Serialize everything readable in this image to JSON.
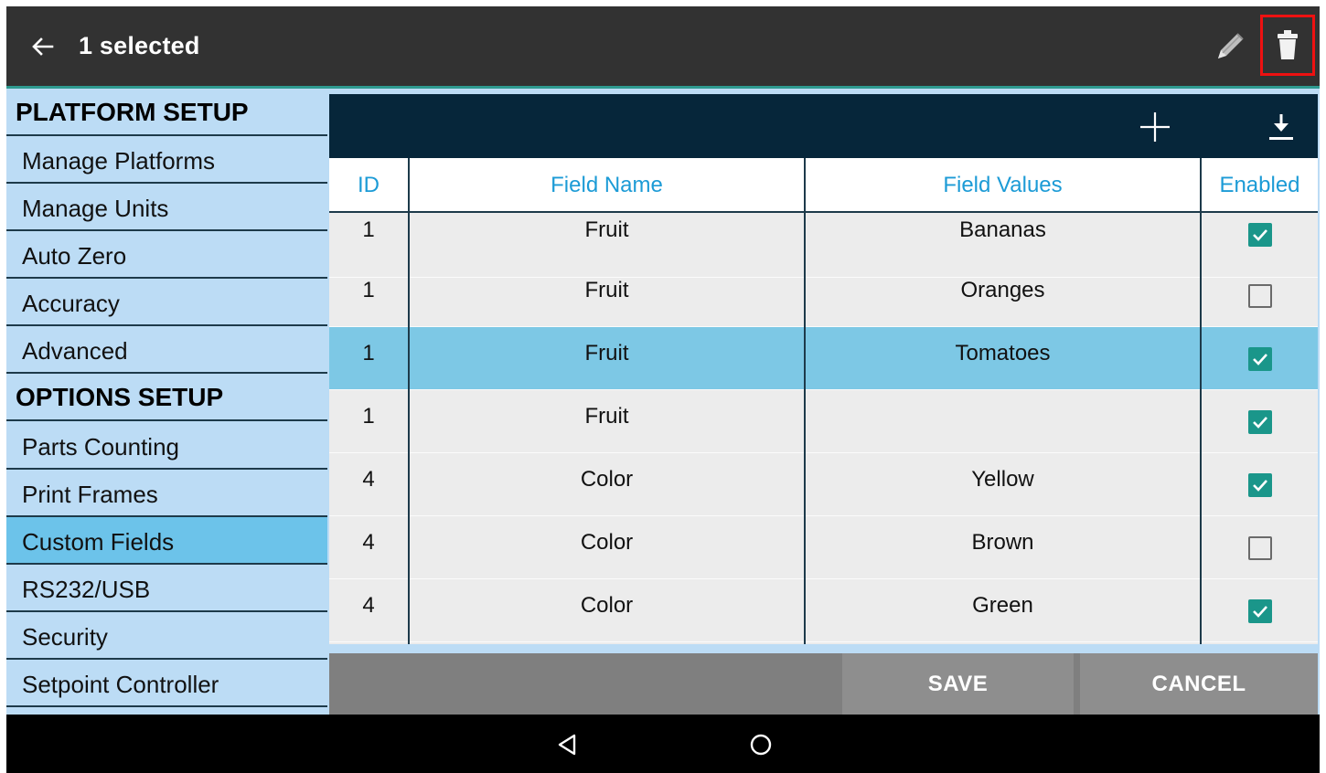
{
  "topbar": {
    "title": "1 selected",
    "icons": {
      "back": "arrow-back-icon",
      "edit": "pencil-icon",
      "delete": "trash-icon"
    },
    "highlight_color": "#ee1111"
  },
  "sidebar": {
    "items": [
      {
        "label": "PLATFORM SETUP",
        "kind": "header"
      },
      {
        "label": "Manage Platforms",
        "kind": "item"
      },
      {
        "label": "Manage Units",
        "kind": "item"
      },
      {
        "label": "Auto Zero",
        "kind": "item"
      },
      {
        "label": "Accuracy",
        "kind": "item"
      },
      {
        "label": "Advanced",
        "kind": "item"
      },
      {
        "label": "OPTIONS SETUP",
        "kind": "header"
      },
      {
        "label": "Parts Counting",
        "kind": "item"
      },
      {
        "label": "Print Frames",
        "kind": "item"
      },
      {
        "label": "Custom Fields",
        "kind": "item",
        "active": true
      },
      {
        "label": "RS232/USB",
        "kind": "item"
      },
      {
        "label": "Security",
        "kind": "item"
      },
      {
        "label": "Setpoint Controller",
        "kind": "item"
      }
    ]
  },
  "table": {
    "toolbar_icons": {
      "add": "plus-icon",
      "download": "download-icon"
    },
    "headers": {
      "id": "ID",
      "field_name": "Field Name",
      "field_values": "Field Values",
      "enabled": "Enabled"
    },
    "rows": [
      {
        "id": "1",
        "field_name": "Fruit",
        "field_value": "Bananas",
        "enabled": true,
        "selected": false
      },
      {
        "id": "1",
        "field_name": "Fruit",
        "field_value": "Oranges",
        "enabled": false,
        "selected": false
      },
      {
        "id": "1",
        "field_name": "Fruit",
        "field_value": "Tomatoes",
        "enabled": true,
        "selected": true
      },
      {
        "id": "1",
        "field_name": "Fruit",
        "field_value": "",
        "enabled": true,
        "selected": false
      },
      {
        "id": "4",
        "field_name": "Color",
        "field_value": "Yellow",
        "enabled": true,
        "selected": false
      },
      {
        "id": "4",
        "field_name": "Color",
        "field_value": "Brown",
        "enabled": false,
        "selected": false
      },
      {
        "id": "4",
        "field_name": "Color",
        "field_value": "Green",
        "enabled": true,
        "selected": false
      }
    ]
  },
  "buttons": {
    "save": "SAVE",
    "cancel": "CANCEL"
  },
  "navbar": {
    "back_icon": "triangle-back-icon",
    "home_icon": "circle-home-icon"
  },
  "colors": {
    "accent": "#1a968a",
    "header_text": "#1c9bd6",
    "sidebar_bg": "#bcdcf5",
    "active_item": "#6cc3ea",
    "selected_row": "#7dc8e5",
    "panel_bar": "#06263a"
  }
}
